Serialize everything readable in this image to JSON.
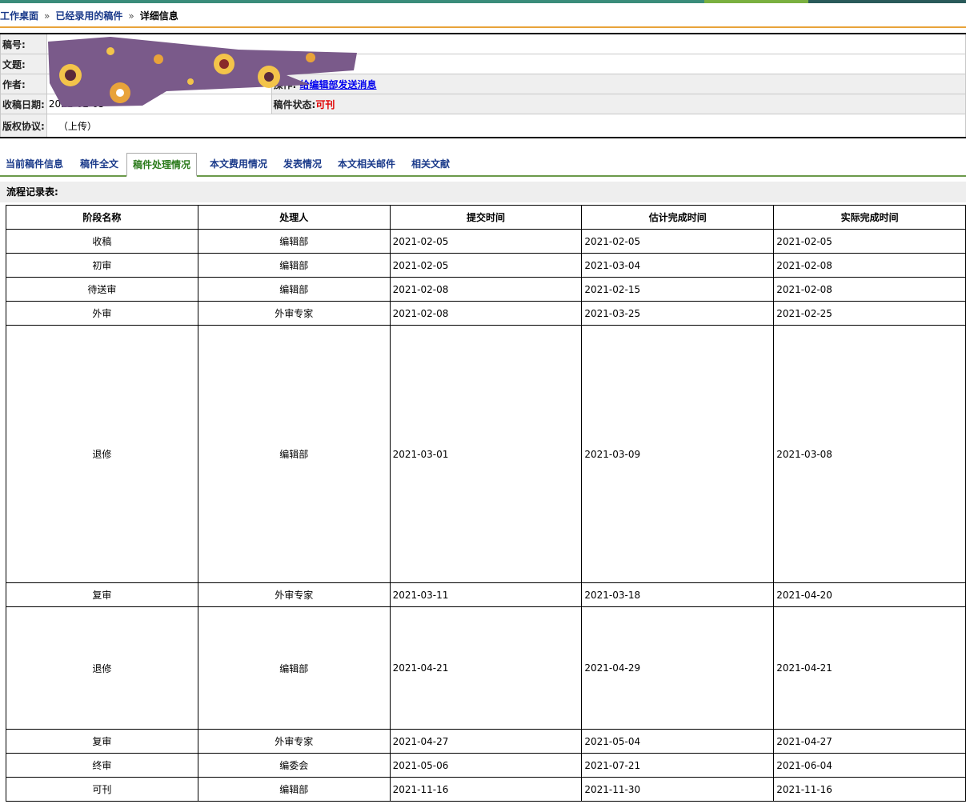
{
  "breadcrumb": {
    "home": "工作桌面",
    "sep1": "»",
    "list": "已经录用的稿件",
    "sep2": "»",
    "current": "详细信息"
  },
  "info": {
    "id_label": "稿号:",
    "title_label": "文题:",
    "author_label": "作者:",
    "received_label": "收稿日期:",
    "received_value": "2021-02-05",
    "copyright_label": "版权协议:",
    "copyright_value": "（上传）",
    "op_label": "操作:",
    "op_link": "给编辑部发送消息",
    "status_label": "稿件状态:",
    "status_value": "可刊"
  },
  "tabs": [
    "当前稿件信息",
    "稿件全文",
    "稿件处理情况",
    "本文费用情况",
    "发表情况",
    "本文相关邮件",
    "相关文献"
  ],
  "section_title": "流程记录表:",
  "flow_table": {
    "headers": [
      "阶段名称",
      "处理人",
      "提交时间",
      "估计完成时间",
      "实际完成时间"
    ],
    "rows": [
      [
        "收稿",
        "编辑部",
        "2021-02-05",
        "2021-02-05",
        "2021-02-05"
      ],
      [
        "初审",
        "编辑部",
        "2021-02-05",
        "2021-03-04",
        "2021-02-08"
      ],
      [
        "待送审",
        "编辑部",
        "2021-02-08",
        "2021-02-15",
        "2021-02-08"
      ],
      [
        "外审",
        "外审专家",
        "2021-02-08",
        "2021-03-25",
        "2021-02-25"
      ],
      [
        "退修",
        "编辑部",
        "2021-03-01",
        "2021-03-09",
        "2021-03-08"
      ],
      [
        "复审",
        "外审专家",
        "2021-03-11",
        "2021-03-18",
        "2021-04-20"
      ],
      [
        "退修",
        "编辑部",
        "2021-04-21",
        "2021-04-29",
        "2021-04-21"
      ],
      [
        "复审",
        "外审专家",
        "2021-04-27",
        "2021-05-04",
        "2021-04-27"
      ],
      [
        "终审",
        "编委会",
        "2021-05-06",
        "2021-07-21",
        "2021-06-04"
      ],
      [
        "可刊",
        "编辑部",
        "2021-11-16",
        "2021-11-30",
        "2021-11-16"
      ]
    ]
  },
  "colors": {
    "link": "#1a3a8a",
    "active_tab": "#2a7a1a",
    "status": "#e00000",
    "accent": "#e8a33a",
    "scribble": "#7a5a8a"
  }
}
